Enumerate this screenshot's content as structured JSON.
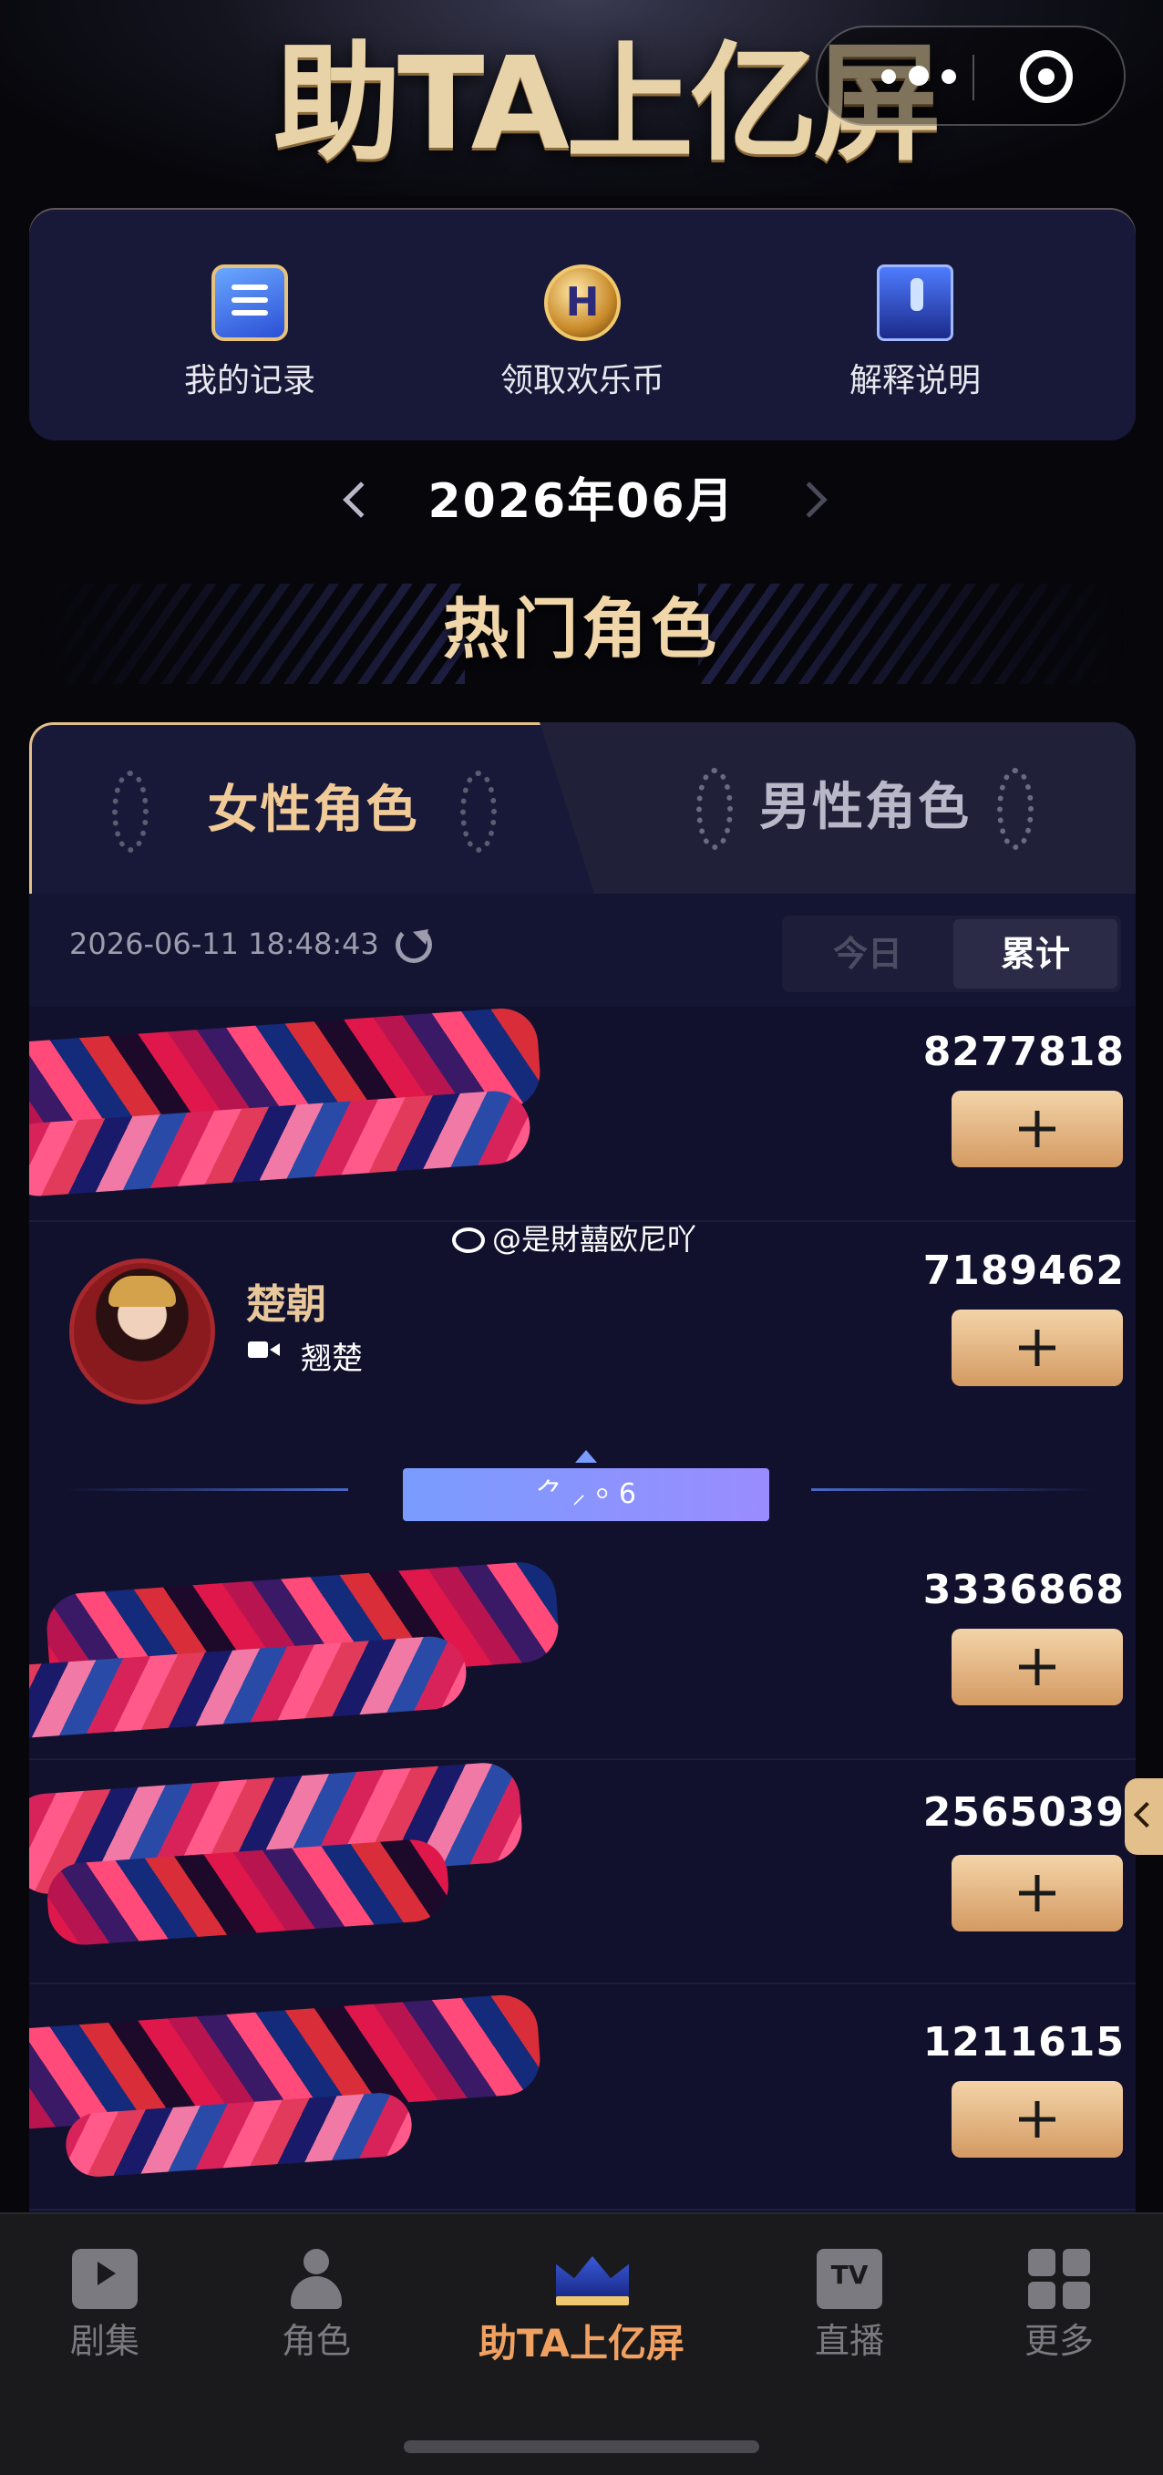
{
  "header": {
    "title": "助TA上亿屏",
    "icons": [
      "more-icon",
      "target-icon"
    ]
  },
  "quick_actions": [
    {
      "label": "我的记录",
      "icon": "record-icon"
    },
    {
      "label": "领取欢乐币",
      "icon": "coin-icon",
      "icon_text": "H"
    },
    {
      "label": "解释说明",
      "icon": "screen-icon"
    }
  ],
  "month": {
    "label": "2026年06月"
  },
  "section": {
    "title": "热门角色"
  },
  "tabs": [
    {
      "label": "女性角色",
      "active": true
    },
    {
      "label": "男性角色",
      "active": false
    }
  ],
  "ranking": {
    "timestamp": "2026-06-11 18:48:43",
    "segments": [
      {
        "label": "今日",
        "active": false
      },
      {
        "label": "累计",
        "active": true
      }
    ],
    "rows": [
      {
        "score": "8277818",
        "name": "",
        "drama": ""
      },
      {
        "score": "7189462",
        "name": "楚朝",
        "drama": "翘楚"
      },
      {
        "score": "3336868",
        "name": "",
        "drama": ""
      },
      {
        "score": "2565039",
        "name": "",
        "drama": ""
      },
      {
        "score": "1211615",
        "name": "",
        "drama": ""
      }
    ],
    "divider_text": "⺈ ⸝ ⸰ 6"
  },
  "watermark": "@是財囍欧尼吖",
  "bottom_nav": [
    {
      "label": "剧集",
      "icon": "tv-icon",
      "active": false
    },
    {
      "label": "角色",
      "icon": "person-star-icon",
      "active": false
    },
    {
      "label": "助TA上亿屏",
      "icon": "crown-icon",
      "active": true
    },
    {
      "label": "直播",
      "icon": "live-tv-icon",
      "icon_text": "TV",
      "active": false
    },
    {
      "label": "更多",
      "icon": "grid-icon",
      "active": false
    }
  ],
  "colors": {
    "accent_gold": "#e2c08c",
    "active_nav": "#f0a060",
    "panel_bg": "#11112e"
  }
}
